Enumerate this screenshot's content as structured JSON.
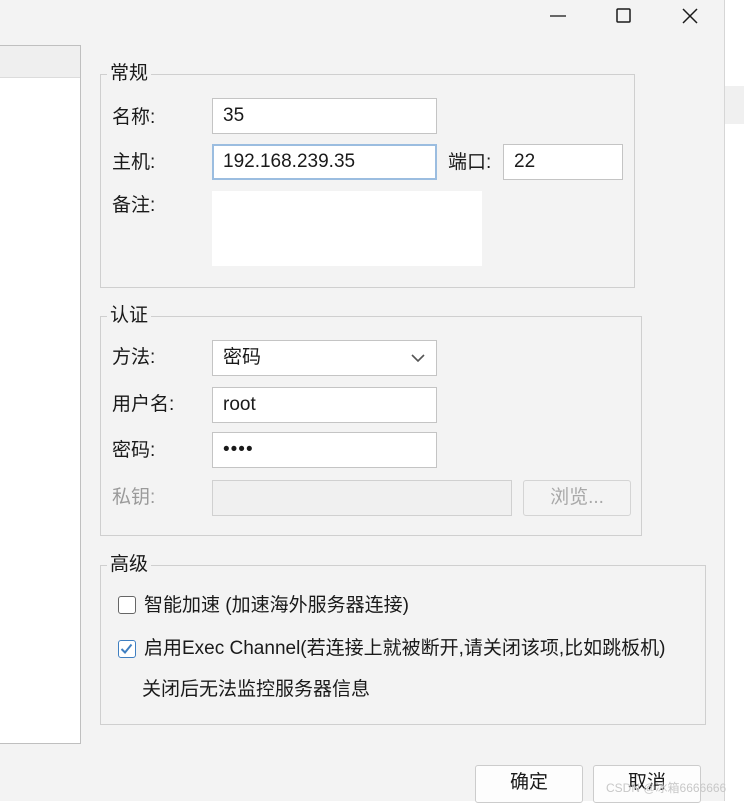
{
  "general": {
    "legend": "常规",
    "name_label": "名称:",
    "name_value": "35",
    "host_label": "主机:",
    "host_value": "192.168.239.35",
    "port_label": "端口:",
    "port_value": "22",
    "note_label": "备注:",
    "note_value": ""
  },
  "auth": {
    "legend": "认证",
    "method_label": "方法:",
    "method_value": "密码",
    "username_label": "用户名:",
    "username_value": "root",
    "password_label": "密码:",
    "password_value": "••••",
    "private_key_label": "私钥:",
    "private_key_value": "",
    "browse_label": "浏览..."
  },
  "advanced": {
    "legend": "高级",
    "smart_accel_label": "智能加速 (加速海外服务器连接)",
    "smart_accel_checked": false,
    "exec_channel_label": "启用Exec Channel(若连接上就被断开,请关闭该项,比如跳板机)",
    "exec_channel_checked": true,
    "exec_channel_note": "关闭后无法监控服务器信息"
  },
  "footer": {
    "ok_label": "确定",
    "cancel_label": "取消"
  },
  "watermark": "CSDN @冰箱6666666",
  "icons": {
    "minimize": "minimize-icon",
    "maximize": "maximize-icon",
    "close": "close-icon",
    "dropdown": "chevron-down-icon",
    "checkmark": "checkmark-icon"
  },
  "colors": {
    "dialog_bg": "#f3f3f3",
    "focus_border": "#9bbde0",
    "checkbox_accent": "#3f7fc1"
  }
}
